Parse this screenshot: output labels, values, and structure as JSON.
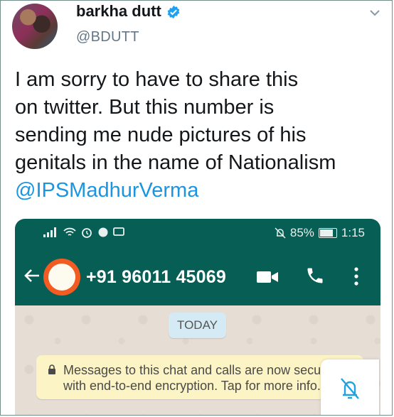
{
  "tweet": {
    "author_name": "barkha dutt",
    "handle": "@BDUTT",
    "text_lines": [
      "I am sorry to have to share this",
      "on twitter. But this number is",
      "sending me nude pictures of his",
      "genitals in the name of Nationalism"
    ],
    "mention": "@IPSMadhurVerma",
    "avatar_icon": "profile-photo",
    "verified_icon": "verified-badge-icon",
    "menu_icon": "chevron-down-icon",
    "colors": {
      "link": "#1b95e0",
      "verified": "#1da1f2"
    }
  },
  "embedded_screenshot": {
    "status_bar": {
      "battery": "85%",
      "time": "1:15",
      "icons": [
        "signal-icon",
        "wifi-icon",
        "alarm-icon",
        "whatsapp-notification-icon",
        "chat-notification-icon",
        "mute-icon"
      ]
    },
    "app_bar": {
      "contact": "+91 96011 45069",
      "icons": [
        "back-arrow-icon",
        "video-call-icon",
        "phone-call-icon",
        "more-options-icon"
      ],
      "color": "#075e54"
    },
    "chat": {
      "date_chip": "TODAY",
      "encryption_notice_line1": "Messages to this chat and calls are now secured",
      "encryption_notice_line2": "with end-to-end encryption. Tap for more info."
    }
  }
}
